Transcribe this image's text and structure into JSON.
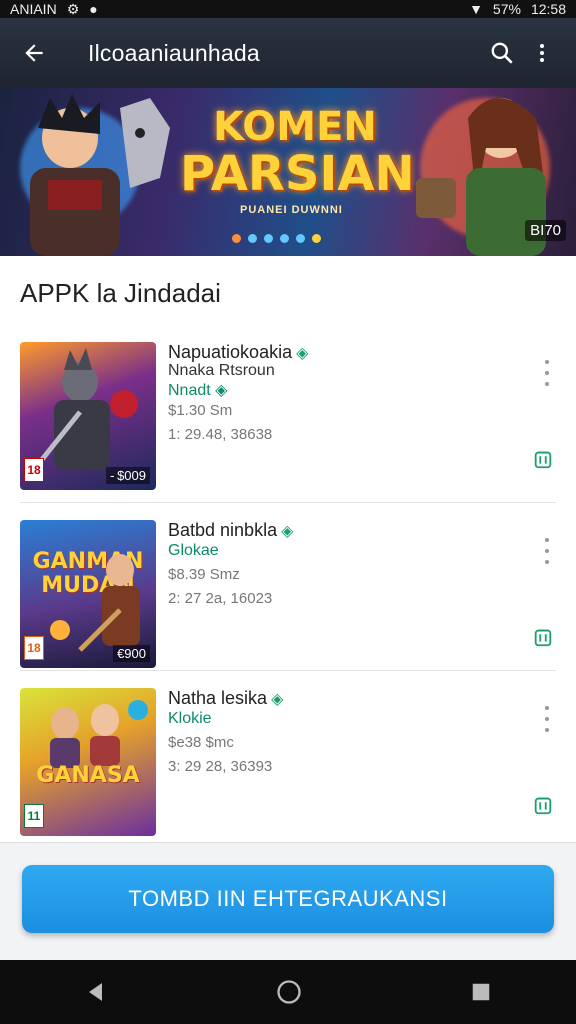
{
  "status_bar": {
    "left_text": "ANIAIN",
    "battery": "57%",
    "time": "12:58"
  },
  "app_bar": {
    "title": "Ilcoaaniaunhada",
    "back_icon": "arrow-left-icon",
    "search_icon": "search-icon",
    "menu_icon": "more-vertical-icon"
  },
  "banner": {
    "headline_1": "KOMEN",
    "headline_2": "PARSIAN",
    "subtitle": "PUANEI DUWNNI",
    "corner_label": "BI70",
    "carousel_dots": 6
  },
  "section": {
    "title": "APPK la Jindadai"
  },
  "apps": [
    {
      "name": "Napuatiokoakia",
      "line2": "Nnaka Rtsroun",
      "category": "Nnadt",
      "size": "$1.30 Sm",
      "downloads": "1: 29.48, 38638",
      "thumb_badge": "18",
      "thumb_price": "- $009",
      "thumb_title": ""
    },
    {
      "name": "Batbd ninbkla",
      "line2": "",
      "category": "Glokae",
      "size": "$8.39 Smz",
      "downloads": "2: 27 2a, 16023",
      "thumb_badge": "18",
      "thumb_price": "€900",
      "thumb_title": "GANMAN MUDAN"
    },
    {
      "name": "Natha lesika",
      "line2": "",
      "category": "Klokie",
      "size": "$e38 $mc",
      "downloads": "3: 29 28, 36393",
      "thumb_badge": "11",
      "thumb_price": "",
      "thumb_title": "GANASA"
    }
  ],
  "cta": {
    "label": "TOMBD IIN EHTEGRAUKANSI"
  },
  "colors": {
    "accent": "#1b8fe0",
    "verified": "#1aa06a",
    "app_bar": "#242b37"
  }
}
